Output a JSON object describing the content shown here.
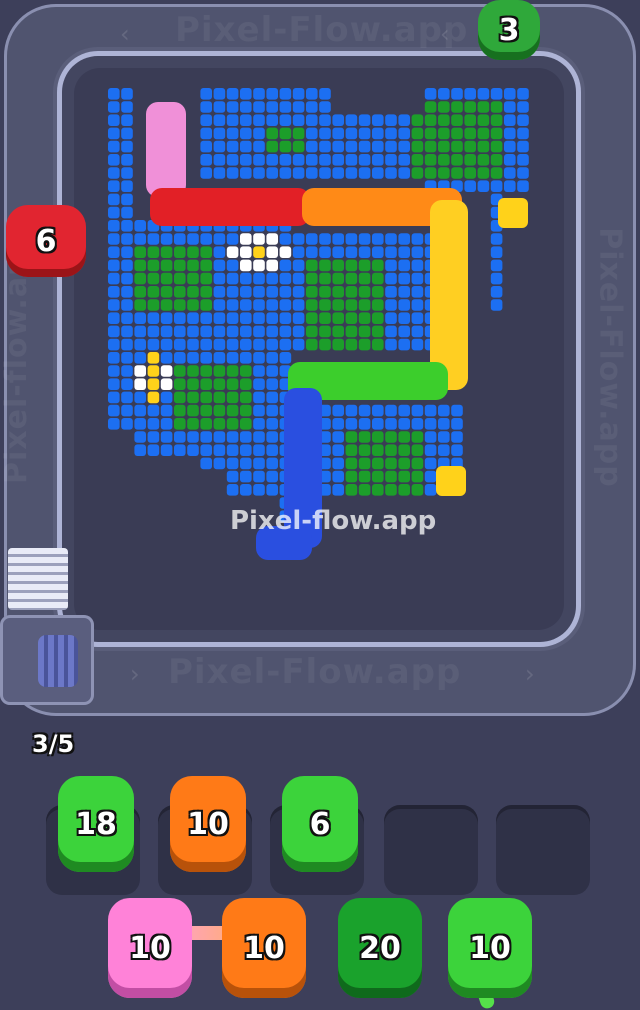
{
  "watermarks": {
    "top": "Pixel-Flow.app",
    "bottom": "Pixel-Flow.app",
    "left": "Pixel-flow.app",
    "right": "Pixel-Flow.app",
    "center": "Pixel-flow.app"
  },
  "conveyor_units": [
    {
      "count": "3",
      "color": "#2fa83a"
    },
    {
      "count": "6",
      "color": "#e12530"
    }
  ],
  "progress": {
    "text": "3/5"
  },
  "queue_slots": [
    {
      "count": "18",
      "color": "#3cd33b"
    },
    {
      "count": "10",
      "color": "#ff7a17"
    },
    {
      "count": "6",
      "color": "#3cd33b"
    },
    {
      "count": "",
      "color": ""
    },
    {
      "count": "",
      "color": ""
    }
  ],
  "bench_units": [
    {
      "count": "10",
      "color": "#ff82d8"
    },
    {
      "count": "10",
      "color": "#ff7a17"
    },
    {
      "count": "20",
      "color": "#1aa22c"
    },
    {
      "count": "10",
      "color": "#3cd33b"
    }
  ],
  "colors": {
    "background": "#3d3f5a",
    "pixel_blue": "#1c6ff2",
    "pixel_green": "#1c9e2a",
    "pixel_white": "#ffffff",
    "pixel_yellow": "#ffd21a",
    "snake_pink": "#f090d8",
    "snake_red": "#e22026",
    "snake_orange": "#ff8a17",
    "snake_yellow": "#ffcf22",
    "snake_green": "#3cce2c",
    "snake_blue": "#2a4fe0"
  }
}
